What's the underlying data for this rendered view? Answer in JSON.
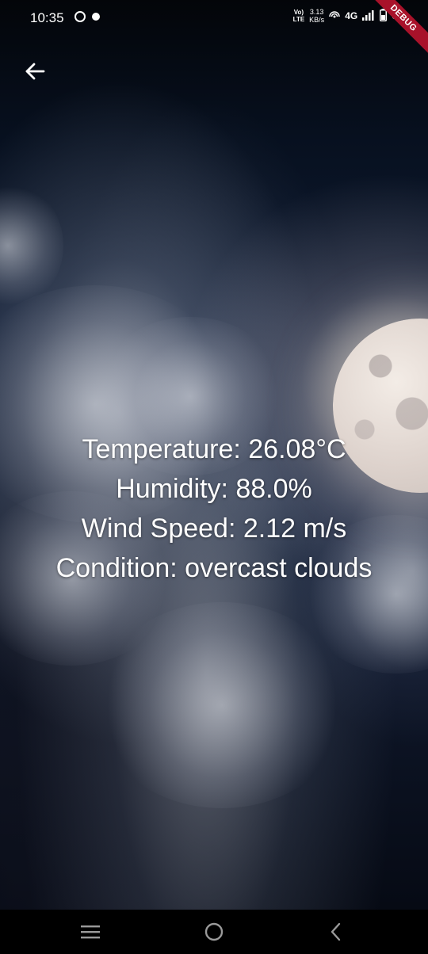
{
  "status_bar": {
    "time": "10:35",
    "volte_top": "Vo)",
    "volte_bottom": "LTE",
    "speed_value": "3.13",
    "speed_unit": "KB/s",
    "network": "4G",
    "battery": "51",
    "debug_banner": "DEBUG",
    "icons": [
      "circle-notification-icon",
      "dot-notification-icon",
      "hotspot-icon",
      "signal-icon",
      "battery-icon"
    ]
  },
  "header": {
    "back_icon": "arrow-left-icon"
  },
  "weather": {
    "temperature": "Temperature: 26.08°C",
    "humidity": "Humidity: 88.0%",
    "wind_speed": "Wind Speed: 2.12 m/s",
    "condition": "Condition: overcast clouds"
  },
  "nav_bar": {
    "recents_icon": "menu-lines-icon",
    "home_icon": "home-circle-icon",
    "back_icon": "chevron-left-icon"
  },
  "colors": {
    "text": "#ffffff",
    "debug_ribbon": "#a8122a",
    "nav_background": "#000000",
    "nav_icon": "#9a9a9a"
  }
}
